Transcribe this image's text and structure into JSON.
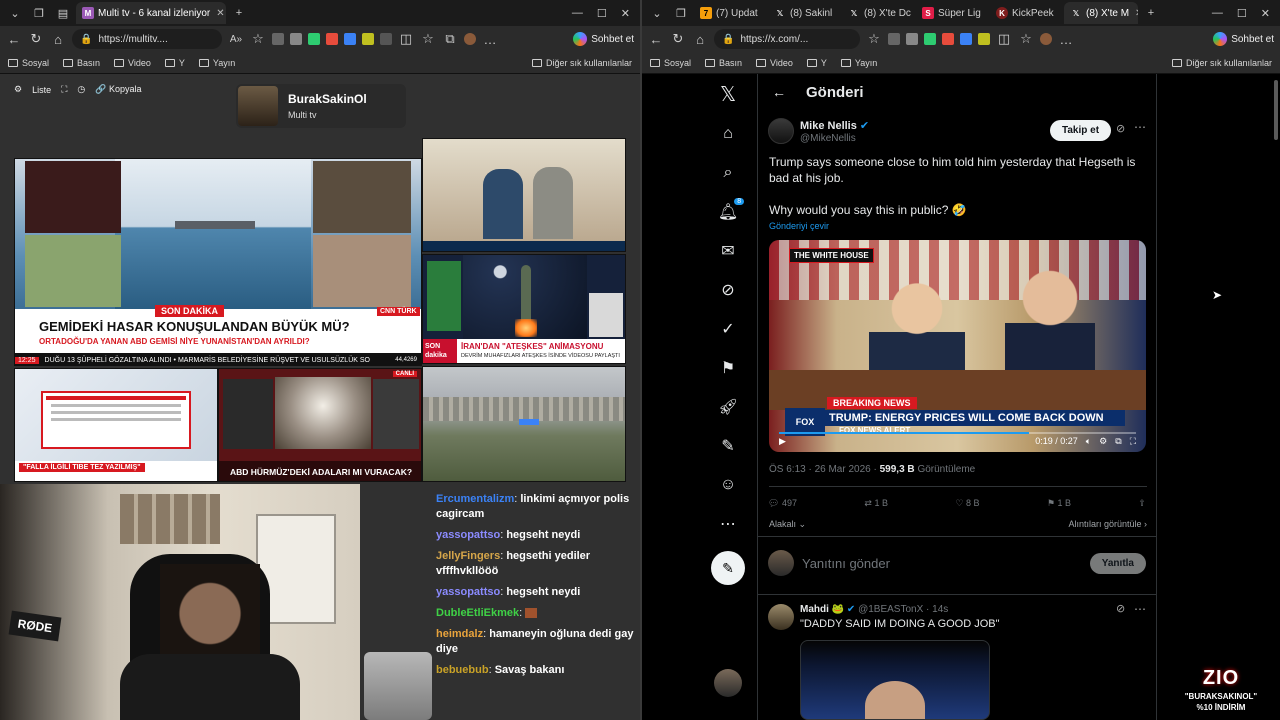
{
  "left_browser": {
    "tab_title": "Multi tv - 6 kanal izleniyor",
    "url": "https://multitv....",
    "chat_label": "Sohbet et",
    "bookmarks": [
      "Sosyal",
      "Basın",
      "Video",
      "Y",
      "Yayın"
    ],
    "other_bookmarks": "Diğer sık kullanılanlar"
  },
  "multitv": {
    "toolbar": {
      "list": "Liste",
      "copy": "Kopyala"
    },
    "profile": {
      "name": "BurakSakinOl",
      "subtitle": "Multi tv"
    },
    "tiles": {
      "cnn_headline": "GEMİDEKİ HASAR KONUŞULANDAN BÜYÜK MÜ?",
      "cnn_sub": "ORTADOĞU'DA YANAN ABD GEMİSİ NİYE YUNANİSTAN'DAN AYRILDI?",
      "cnn_breaking": "SON DAKİKA",
      "cnn_ticker": "DUĞU 13 ŞÜPHELİ GÖZALTINA ALINDI • MARMARİS BELEDİYESİNE RÜŞVET VE USULSÜZLÜK SO",
      "cnn_time": "12:25",
      "cnn_live": "CANLI",
      "cnn_logo": "CNN TÜRK",
      "cnn_viewers": "44,4269",
      "tile3_caption": "İRAN'DAN \"ATEŞKES\" ANİMASYONU",
      "tile3_sub": "DEVRİM MUHAFIZLARI ATEŞKES İSİNDE VİDEOSU PAYLAŞTI",
      "tile3_son": "SON",
      "tile3_dakika": "dakika",
      "tile4_caption": "\"FALLA İLGİLİ TIBE TEZ YAZILMIŞ\"",
      "tile5_caption": "ABD HÜRMÜZ'DEKİ ADALARI MI VURACAK?",
      "tile5_live": "CANLI"
    },
    "chat": [
      {
        "user": "Ercumentalizm",
        "text": "linkimi açmıyor polis cagircam",
        "color": "#3b82f6"
      },
      {
        "user": "yassopattso",
        "text": "hegseht neydi",
        "color": "#8b8bff"
      },
      {
        "user": "JellyFingers",
        "text": "hegsethi yediler vfffhvkllööö",
        "color": "#d6a64a"
      },
      {
        "user": "yassopattso",
        "text": "hegseht neydi",
        "color": "#8b8bff"
      },
      {
        "user": "DubleEtliEkmek",
        "text": "",
        "color": "#3fd146"
      },
      {
        "user": "heimdalz",
        "text": "hamaneyin oğluna dedi gay diye",
        "color": "#e8a33c"
      },
      {
        "user": "bebuebub",
        "text": "Savaş bakanı",
        "color": "#c9a227"
      }
    ],
    "mic_brand": "RØDE"
  },
  "right_browser": {
    "tabs": [
      "(7) Updat",
      "(8) Sakinl",
      "(8) X'te Dc",
      "Süper Lig",
      "KickPeek",
      "(8) X'te M"
    ],
    "url": "https://x.com/...",
    "chat_label": "Sohbet et",
    "bookmarks": [
      "Sosyal",
      "Basın",
      "Video",
      "Y",
      "Yayın"
    ],
    "other_bookmarks": "Diğer sık kullanılanlar"
  },
  "x": {
    "header": "Gönderi",
    "notif_count": "8",
    "tweet": {
      "name": "Mike Nellis",
      "handle": "@MikeNellis",
      "follow": "Takip et",
      "text1": "Trump says someone close to him told him yesterday that Hegseth is bad at his job.",
      "text2": "Why would you say this in public? 🤣",
      "translate": "Gönderiyi çevir",
      "video_badge": "THE WHITE HOUSE",
      "breaking": "BREAKING NEWS",
      "lower_third": "TRUMP: ENERGY PRICES WILL COME BACK DOWN",
      "fox_alert": "FOX NEWS ALERT",
      "video_time": "0:19 / 0:27",
      "video_progress": 0.7,
      "time": "ÖS 6:13 · 26 Mar 2026",
      "views": "599,3 B",
      "views_label": "Görüntüleme",
      "replies": "497",
      "retweets": "1 B",
      "likes": "8 B",
      "bookmarks": "1 B",
      "related": "Alakalı",
      "quotes": "Alıntıları görüntüle"
    },
    "reply_placeholder": "Yanıtını gönder",
    "reply_button": "Yanıtla",
    "reply_tweet": {
      "name": "Mahdi 🐸",
      "handle": "@1BEASTonX · 14s",
      "text": "\"DADDY SAID IM DOING A GOOD JOB\""
    }
  },
  "overlay": {
    "brand": "ZIO",
    "line1": "\"BURAKSAKINOL\"",
    "line2": "%10 İNDİRİM"
  }
}
